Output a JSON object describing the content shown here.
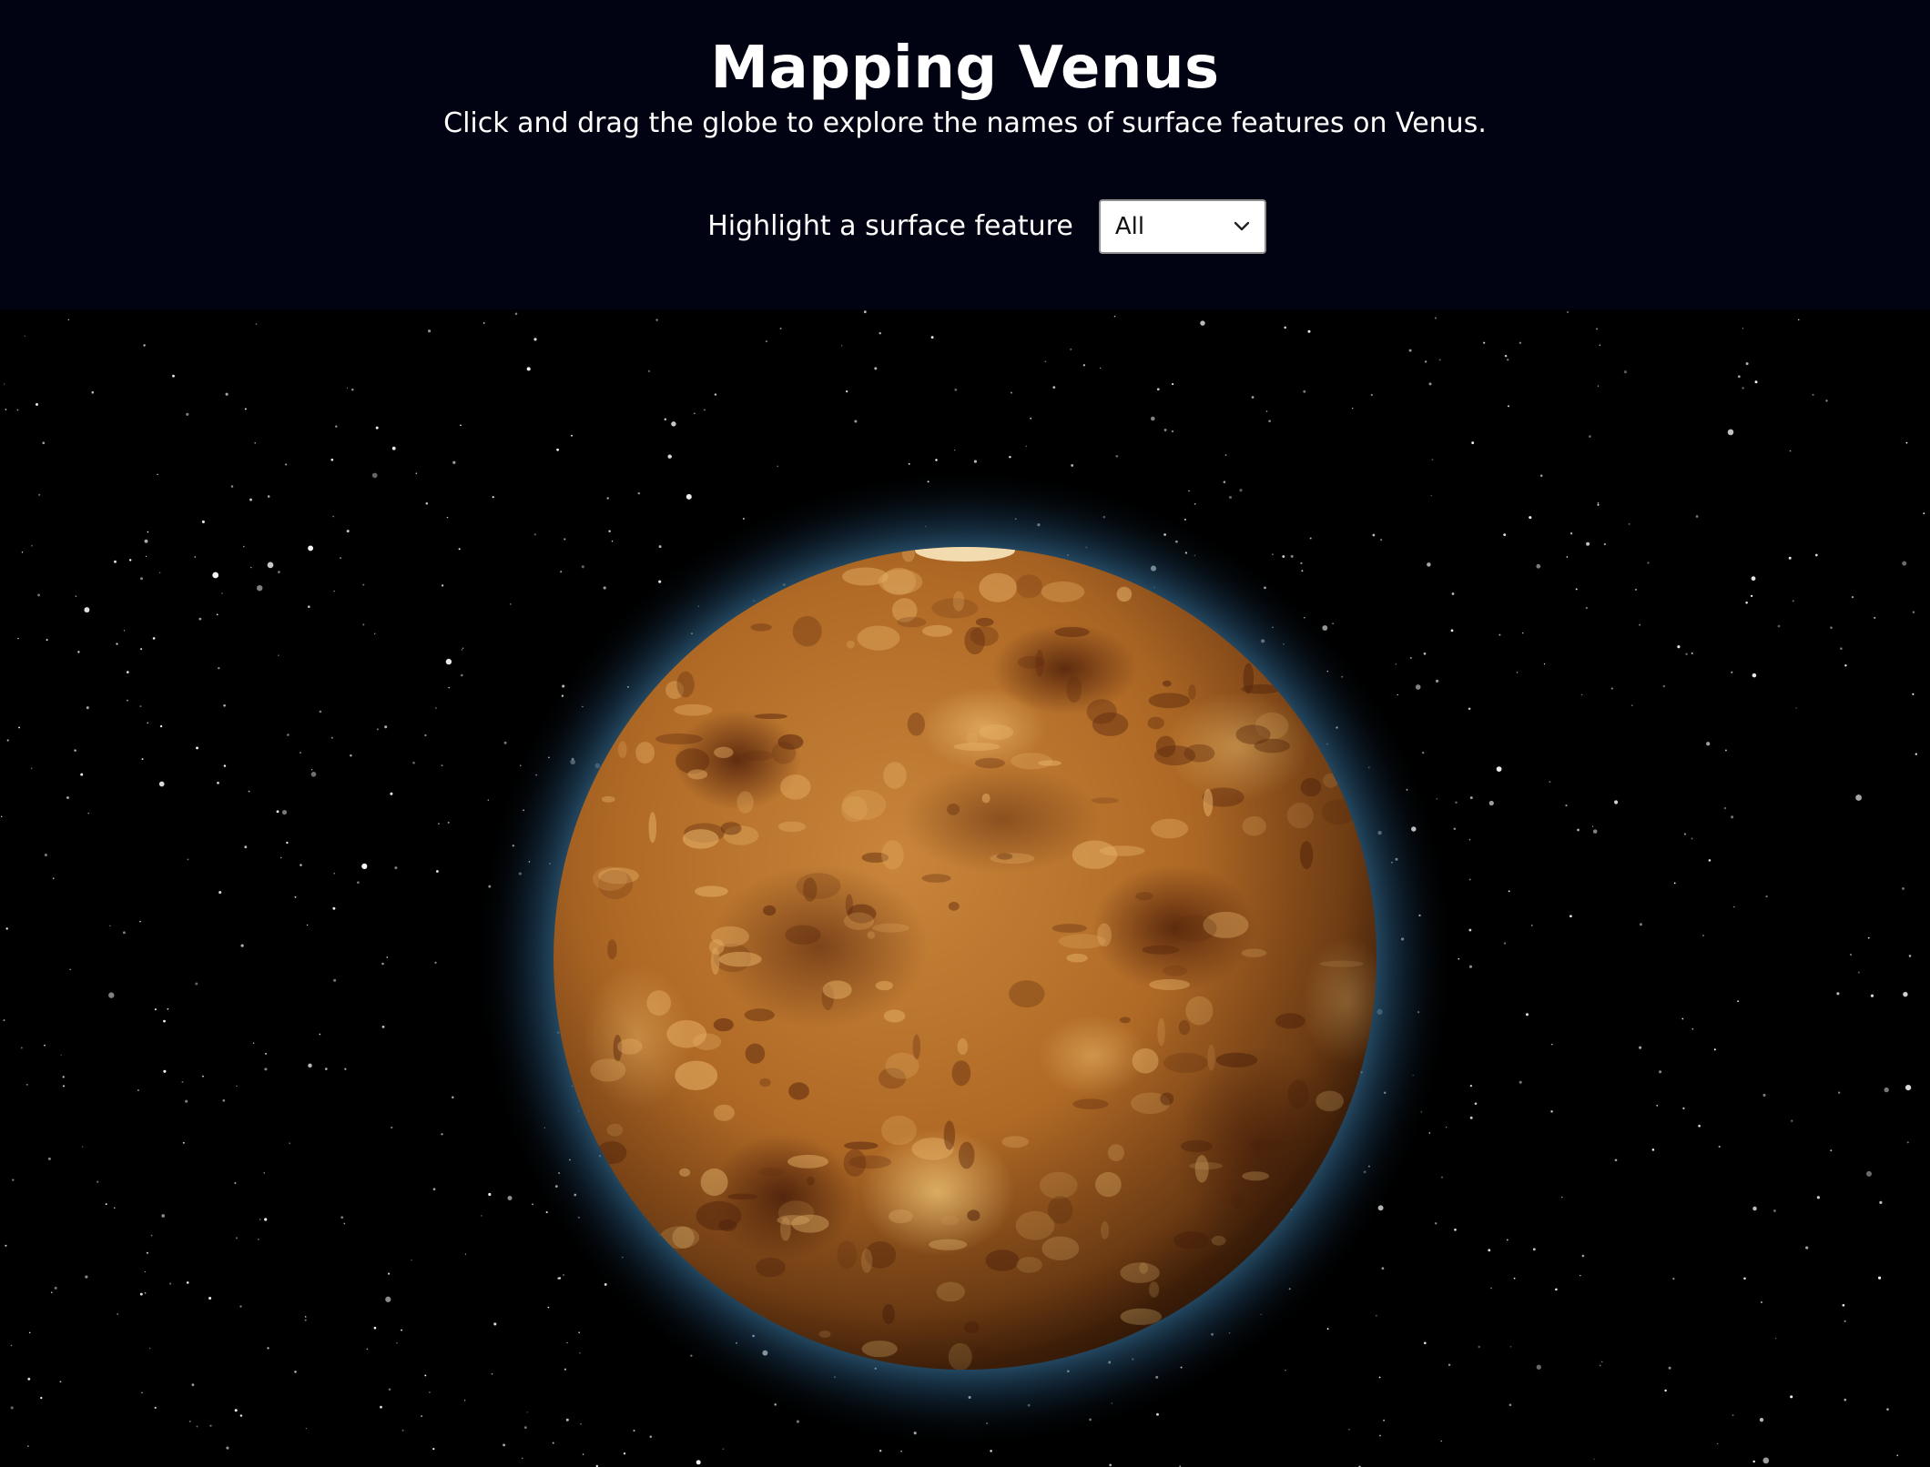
{
  "header": {
    "title": "Mapping Venus",
    "subtitle": "Click and drag the globe to explore the names of surface features on Venus."
  },
  "feature_filter": {
    "label": "Highlight a surface feature",
    "selected": "All",
    "icon": "chevron-down-icon"
  },
  "colors": {
    "header_bg": "#010212",
    "space_bg": "#000000",
    "planet_base": "#b8732a",
    "planet_dark": "#6e3510",
    "planet_light": "#e0ad5c",
    "atmosphere_glow": "#2c5a7a"
  }
}
